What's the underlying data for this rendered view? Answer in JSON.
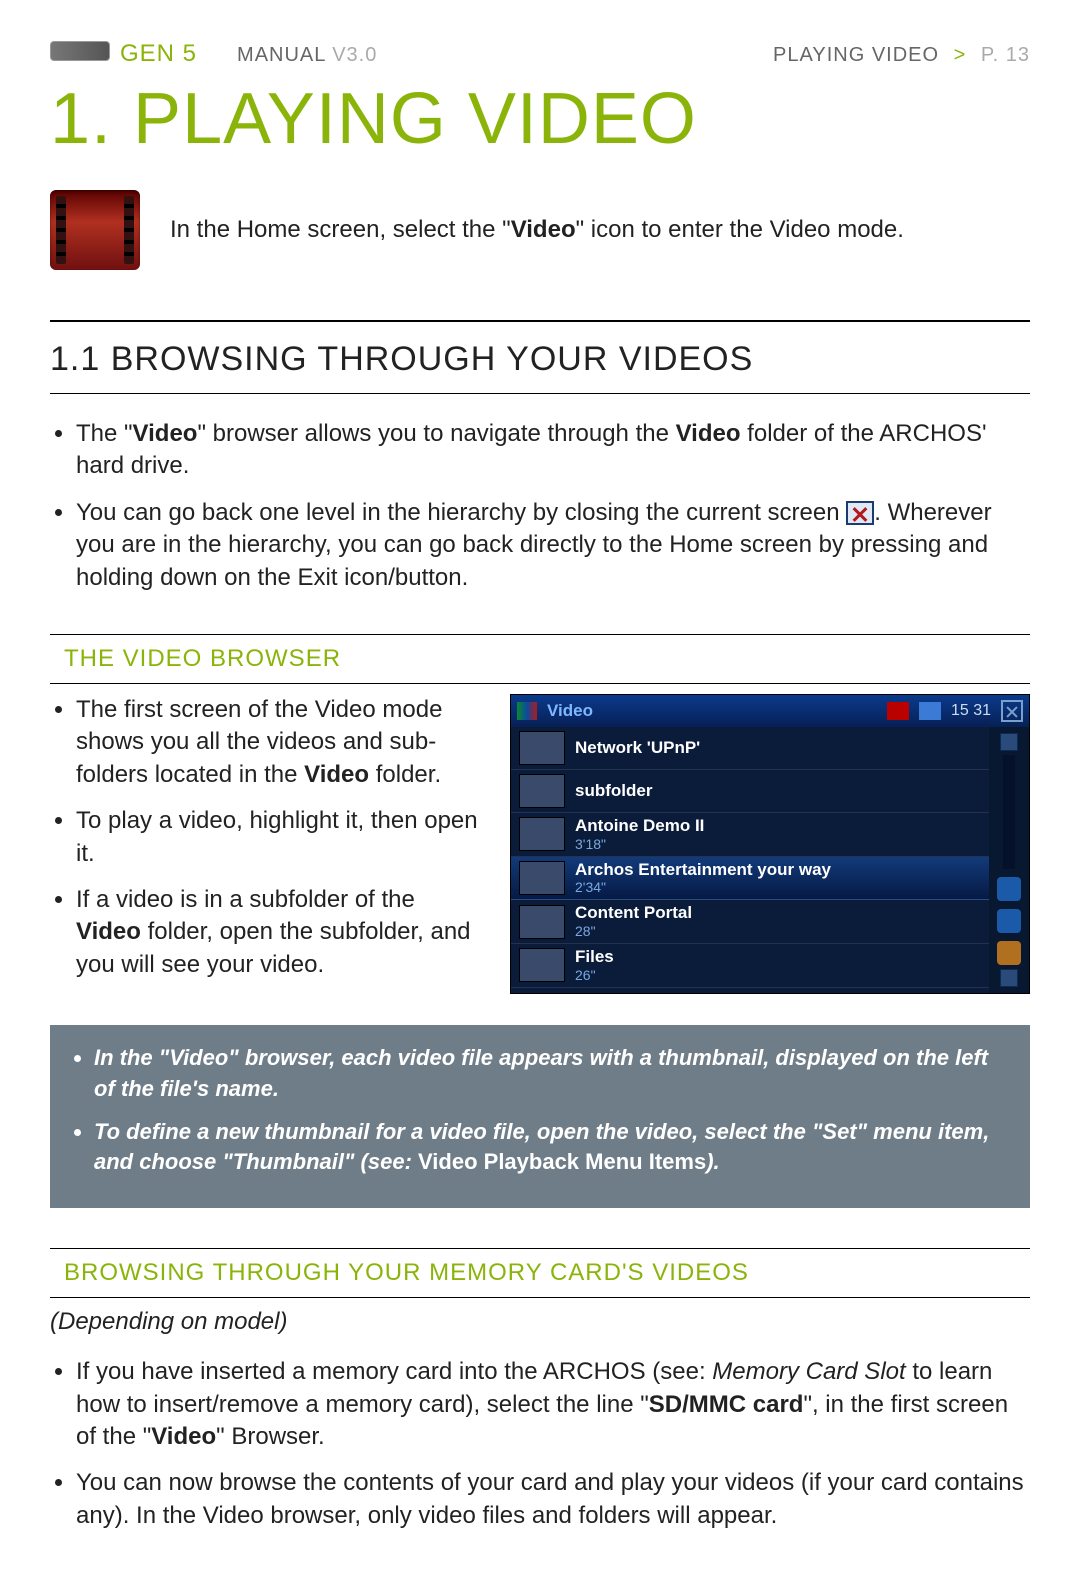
{
  "header": {
    "gen": "GEN 5",
    "manual": "MANUAL",
    "version": "V3.0",
    "crumb_section": "PLAYING VIDEO",
    "crumb_page": "P. 13"
  },
  "title": "1. PLAYING VIDEO",
  "intro": {
    "pre": "In the Home screen, select the \"",
    "bold": "Video",
    "post": "\" icon to enter the Video mode."
  },
  "section11": {
    "heading": "1.1   BROWSING THROUGH YOUR VIDEOS",
    "b1_a": "The \"",
    "b1_bold1": "Video",
    "b1_b": "\" browser allows you to navigate through the ",
    "b1_bold2": "Video",
    "b1_c": " folder of the ARCHOS' hard drive.",
    "b2_a": "You can go back one level in the hierarchy by closing the current screen ",
    "b2_b": ". Wherever you are in the hierarchy, you can go back directly to the Home screen by pressing and holding down on the Exit icon/button."
  },
  "videoBrowser": {
    "heading": "THE VIDEO BROWSER",
    "l1_a": "The first screen of the Video mode shows you all the videos and sub-folders located in the ",
    "l1_bold": "Video",
    "l1_b": " folder.",
    "l2": "To play a video, highlight it, then open it.",
    "l3_a": "If a video is in a subfolder of the ",
    "l3_bold": "Video",
    "l3_b": " folder, open the subfolder, and you will see your video."
  },
  "screenshot": {
    "title": "Video",
    "clock": "15 31",
    "rows": [
      {
        "title": "Network 'UPnP'",
        "sub": ""
      },
      {
        "title": "subfolder",
        "sub": ""
      },
      {
        "title": "Antoine Demo II",
        "sub": "3'18\""
      },
      {
        "title": "Archos Entertainment your way",
        "sub": "2'34\""
      },
      {
        "title": "Content Portal",
        "sub": "28\""
      },
      {
        "title": "Files",
        "sub": "26\""
      }
    ],
    "selected_index": 3
  },
  "notes": {
    "n1": "In the \"Video\" browser, each video file appears with a thumbnail, displayed on the left of the file's name.",
    "n2_a": "To define a new thumbnail for a video file, open the video, select the \"Set\" menu item, and choose \"Thumbnail\" (see: ",
    "n2_bold": "Video Playback Menu Items",
    "n2_b": ")."
  },
  "memCard": {
    "heading": "BROWSING THROUGH YOUR MEMORY CARD'S VIDEOS",
    "depending": "(Depending on model)",
    "m1_a": "If you have inserted a memory card into the ARCHOS (see: ",
    "m1_it": "Memory Card Slot",
    "m1_b": " to learn how to insert/remove a memory card), select the line \"",
    "m1_bold": "SD/MMC card",
    "m1_c": "\", in the first screen of the \"",
    "m1_bold2": "Video",
    "m1_d": "\" Browser.",
    "m2": "You can now browse the contents of your card and play your videos (if your card contains any). In the Video browser, only video files and folders will appear."
  }
}
